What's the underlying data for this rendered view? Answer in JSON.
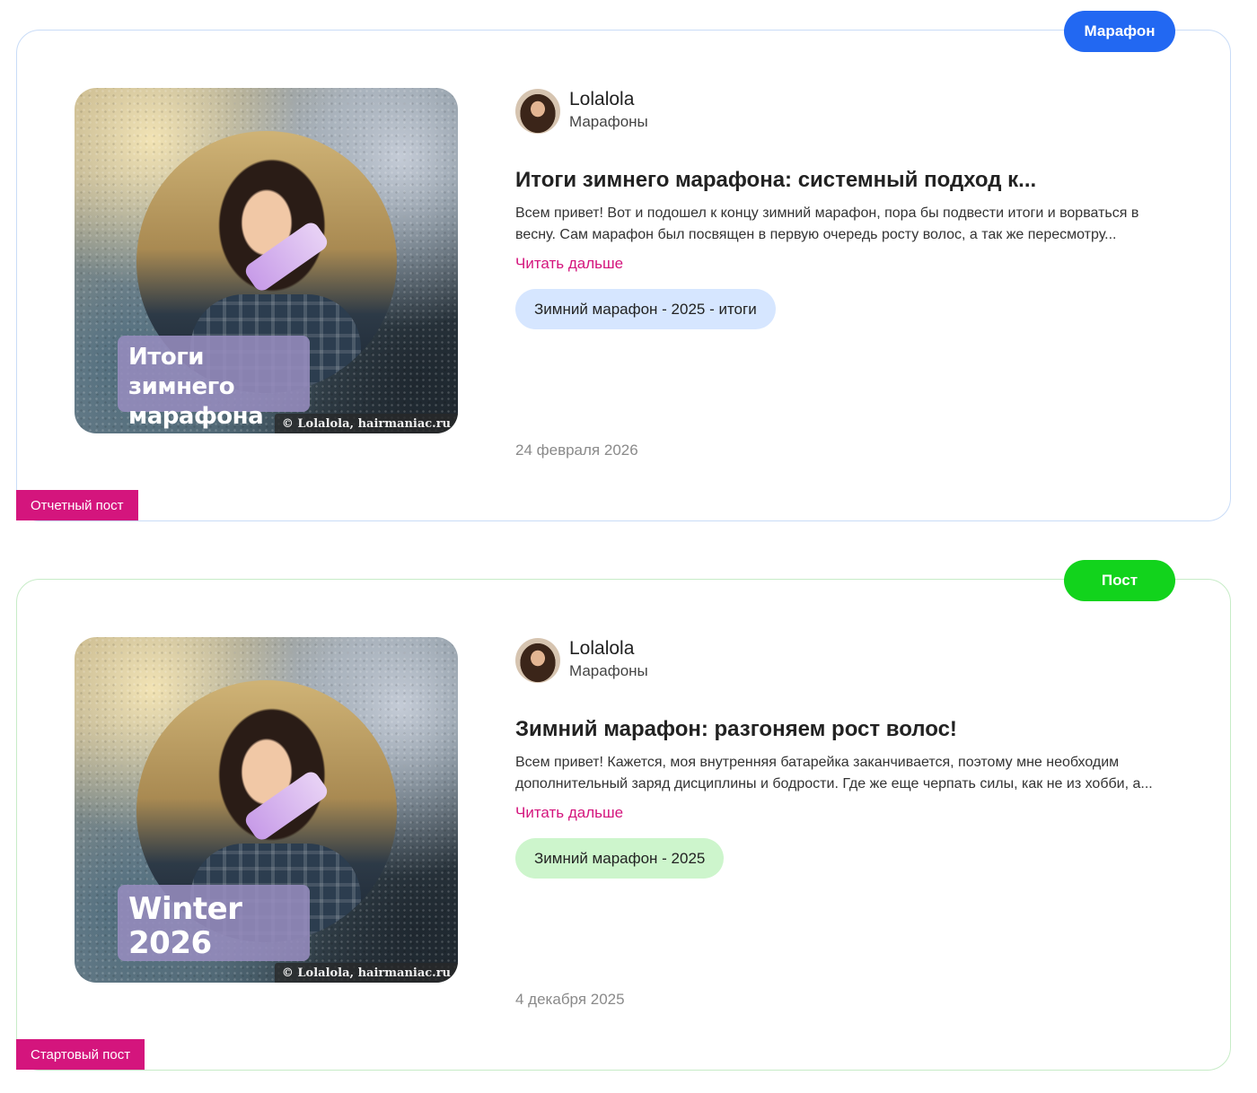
{
  "posts": [
    {
      "type_badge": "Марафон",
      "corner_label": "Отчетный пост",
      "image_overlay": [
        "Итоги зимнего",
        "марафона"
      ],
      "image_copyright": "© Lolalola, hairmaniac.ru",
      "author": {
        "name": "Lolalola",
        "category": "Марафоны"
      },
      "title": "Итоги зимнего марафона: системный подход к...",
      "excerpt": "Всем привет! Вот и подошел к концу зимний марафон, пора бы подвести итоги и ворваться в весну. Сам марафон был посвящен в первую очередь росту волос, а так же пересмотру...",
      "read_more": "Читать дальше",
      "tag": "Зимний марафон - 2025 - итоги",
      "date": "24 февраля 2026"
    },
    {
      "type_badge": "Пост",
      "corner_label": "Стартовый пост",
      "image_overlay": [
        "Winter",
        "2026"
      ],
      "image_copyright": "© Lolalola, hairmaniac.ru",
      "author": {
        "name": "Lolalola",
        "category": "Марафоны"
      },
      "title": "Зимний марафон: разгоняем рост волос!",
      "excerpt": "Всем привет! Кажется, моя внутренняя батарейка заканчивается, поэтому мне необходим дополнительный заряд дисциплины и бодрости. Где же еще черпать силы, как не из хобби, а...",
      "read_more": "Читать дальше",
      "tag": "Зимний марафон - 2025",
      "date": "4 декабря 2025"
    }
  ],
  "colors": {
    "badge_marathon": "#2268f2",
    "badge_post": "#12d31c",
    "accent_pink": "#d4157d",
    "tag_blue": "#d6e6ff",
    "tag_green": "#cdf5cc"
  }
}
